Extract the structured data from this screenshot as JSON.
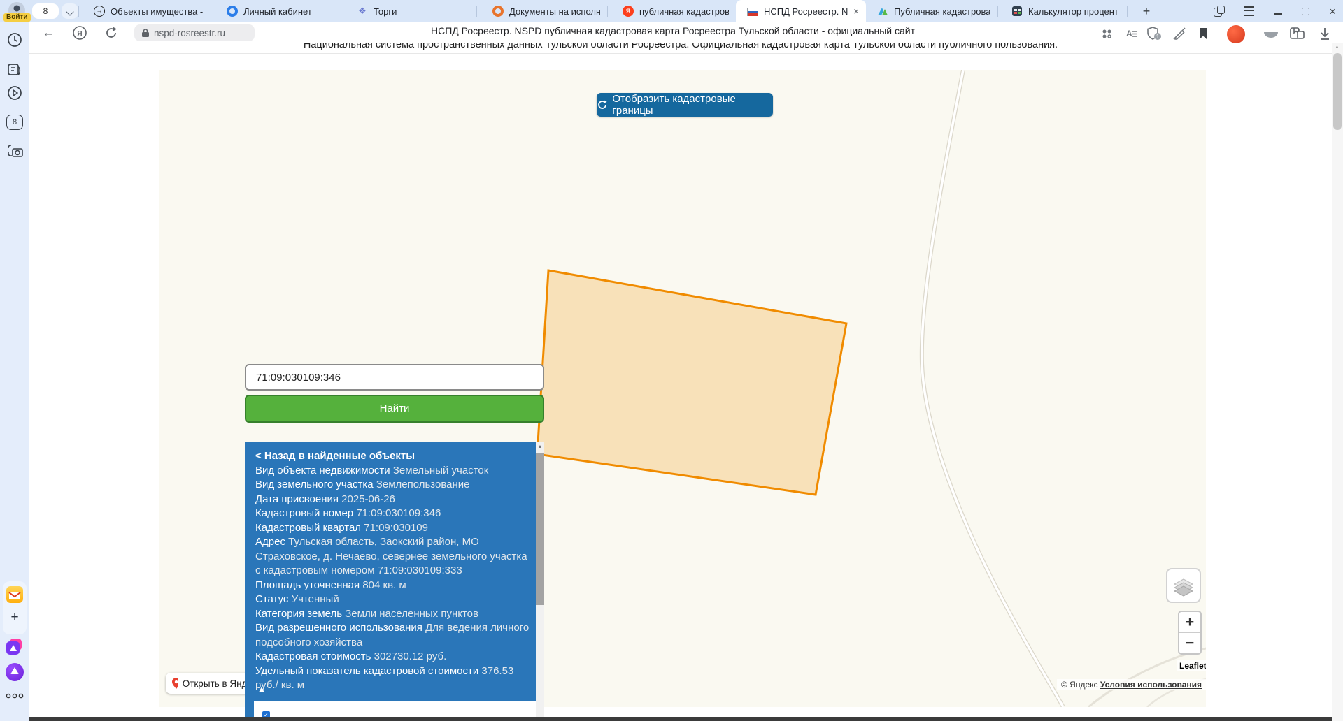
{
  "browser": {
    "login_badge": "Войти",
    "tab_count": "8",
    "new_tab": "+",
    "close_tab": "×",
    "ya_letter": "Я",
    "translate_letter": "A",
    "tabs": [
      {
        "label": "Объекты имущества -",
        "icon": "arrow-circle-favicon"
      },
      {
        "label": "Личный кабинет",
        "icon": "blue-ring-favicon"
      },
      {
        "label": "Торги",
        "icon": "emblem-favicon"
      },
      {
        "label": "Документы на исполн",
        "icon": "orange-ring-favicon"
      },
      {
        "label": "публичная кадастрова",
        "icon": "yandex-favicon"
      },
      {
        "label": "НСПД Росреестр. NS",
        "icon": "russia-flag-favicon",
        "active": true
      },
      {
        "label": "Публичная кадастрова",
        "icon": "nspd-logo-favicon"
      },
      {
        "label": "Калькулятор процент",
        "icon": "calculator-favicon"
      }
    ],
    "url": "nspd-rosreestr.ru",
    "page_title": "НСПД Росреестр. NSPD публичная кадастровая карта Росреестра Тульской области - официальный сайт",
    "shield_badge": "1"
  },
  "page": {
    "header": "Национальная система пространственных данных Тульской области Росреестра. Официальная кадастровая карта Тульской области публичного пользования.",
    "show_borders_button": "Отобразить кадастровые границы",
    "search_value": "71:09:030109:346",
    "find_button": "Найти",
    "open_in_yandex": "Открыть в Янде",
    "collapse_arrow": "▲",
    "checkbox_check": "✓"
  },
  "panel": {
    "back_link": "< Назад в найденные объекты",
    "rows": [
      {
        "label": "Вид объекта недвижимости",
        "value": "Земельный участок"
      },
      {
        "label": "Вид земельного участка",
        "value": "Землепользование"
      },
      {
        "label": "Дата присвоения",
        "value": "2025-06-26"
      },
      {
        "label": "Кадастровый номер",
        "value": "71:09:030109:346"
      },
      {
        "label": "Кадастровый квартал",
        "value": "71:09:030109"
      },
      {
        "label": "Адрес",
        "value": "Тульская область, Заокский район, МО Страховское, д. Нечаево, севернее земельного участка с кадастровым номером 71:09:030109:333"
      },
      {
        "label": "Площадь уточненная",
        "value": "804 кв. м"
      },
      {
        "label": "Статус",
        "value": "Учтенный"
      },
      {
        "label": "Категория земель",
        "value": "Земли населенных пунктов"
      },
      {
        "label": "Вид разрешенного использования",
        "value": "Для ведения личного подсобного хозяйства"
      },
      {
        "label": "Кадастровая стоимость",
        "value": "302730.12 руб."
      },
      {
        "label": "Удельный показатель кадастровой стоимости",
        "value": "376.53 руб./ кв. м"
      }
    ]
  },
  "map": {
    "zoom_in": "+",
    "zoom_out": "−",
    "leaflet": "Leaflet",
    "copyright": "© Яндекс ",
    "terms_link": "Условия использования"
  },
  "colors": {
    "panel_blue": "#2a76b9",
    "button_blue": "#15689e",
    "button_green": "#55b13c",
    "parcel_orange": "#f08b00",
    "arrow_green": "#76c276"
  }
}
